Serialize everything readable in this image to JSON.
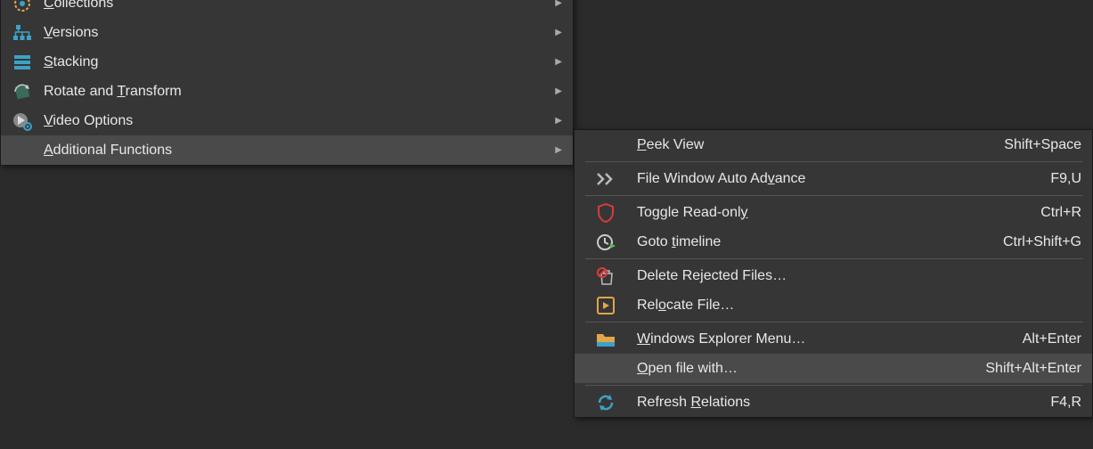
{
  "menu1": {
    "items": [
      {
        "id": "collections",
        "labelPrefix": "",
        "mnemonic": "C",
        "labelSuffix": "ollections",
        "icon": "collections-icon",
        "hasSubmenu": true
      },
      {
        "id": "versions",
        "labelPrefix": "",
        "mnemonic": "V",
        "labelSuffix": "ersions",
        "icon": "versions-icon",
        "hasSubmenu": true
      },
      {
        "id": "stacking",
        "labelPrefix": "",
        "mnemonic": "S",
        "labelSuffix": "tacking",
        "icon": "stacking-icon",
        "hasSubmenu": true
      },
      {
        "id": "rotate",
        "labelPrefix": "Rotate and ",
        "mnemonic": "T",
        "labelSuffix": "ransform",
        "icon": "rotate-icon",
        "hasSubmenu": true
      },
      {
        "id": "video",
        "labelPrefix": "",
        "mnemonic": "V",
        "labelSuffix": "ideo Options",
        "icon": "video-icon",
        "hasSubmenu": true
      },
      {
        "id": "additional",
        "labelPrefix": "",
        "mnemonic": "A",
        "labelSuffix": "dditional Functions",
        "icon": "",
        "hasSubmenu": true,
        "highlighted": true
      }
    ]
  },
  "menu2": {
    "groups": [
      [
        {
          "id": "peek",
          "labelPrefix": "",
          "mnemonic": "P",
          "labelSuffix": "eek View",
          "icon": "",
          "shortcut": "Shift+Space"
        }
      ],
      [
        {
          "id": "autoadv",
          "labelPrefix": "File Window Auto Ad",
          "mnemonic": "v",
          "labelSuffix": "ance",
          "icon": "advance-icon",
          "shortcut": "F9,U"
        }
      ],
      [
        {
          "id": "readonly",
          "labelPrefix": "Toggle Read-onl",
          "mnemonic": "y",
          "labelSuffix": "",
          "icon": "shield-icon",
          "shortcut": "Ctrl+R"
        },
        {
          "id": "timeline",
          "labelPrefix": "Goto ",
          "mnemonic": "t",
          "labelSuffix": "imeline",
          "icon": "timeline-icon",
          "shortcut": "Ctrl+Shift+G"
        }
      ],
      [
        {
          "id": "delreject",
          "labelPrefix": "Delete Rejected Files…",
          "mnemonic": "",
          "labelSuffix": "",
          "icon": "delete-icon",
          "shortcut": ""
        },
        {
          "id": "relocate",
          "labelPrefix": "Rel",
          "mnemonic": "o",
          "labelSuffix": "cate File…",
          "icon": "relocate-icon",
          "shortcut": ""
        }
      ],
      [
        {
          "id": "explorer",
          "labelPrefix": "",
          "mnemonic": "W",
          "labelSuffix": "indows Explorer Menu…",
          "icon": "folder-icon",
          "shortcut": "Alt+Enter"
        },
        {
          "id": "openwith",
          "labelPrefix": "",
          "mnemonic": "O",
          "labelSuffix": "pen file with…",
          "icon": "",
          "shortcut": "Shift+Alt+Enter",
          "highlighted": true
        }
      ],
      [
        {
          "id": "refresh",
          "labelPrefix": "Refresh ",
          "mnemonic": "R",
          "labelSuffix": "elations",
          "icon": "refresh-icon",
          "shortcut": "F4,R"
        }
      ]
    ]
  },
  "colors": {
    "shield": "#d93b3b",
    "timeline": "#5fb85f",
    "folder": "#e0a64a",
    "refresh": "#3da2c7",
    "version": "#3da2c7",
    "stack": "#3da2c7"
  }
}
